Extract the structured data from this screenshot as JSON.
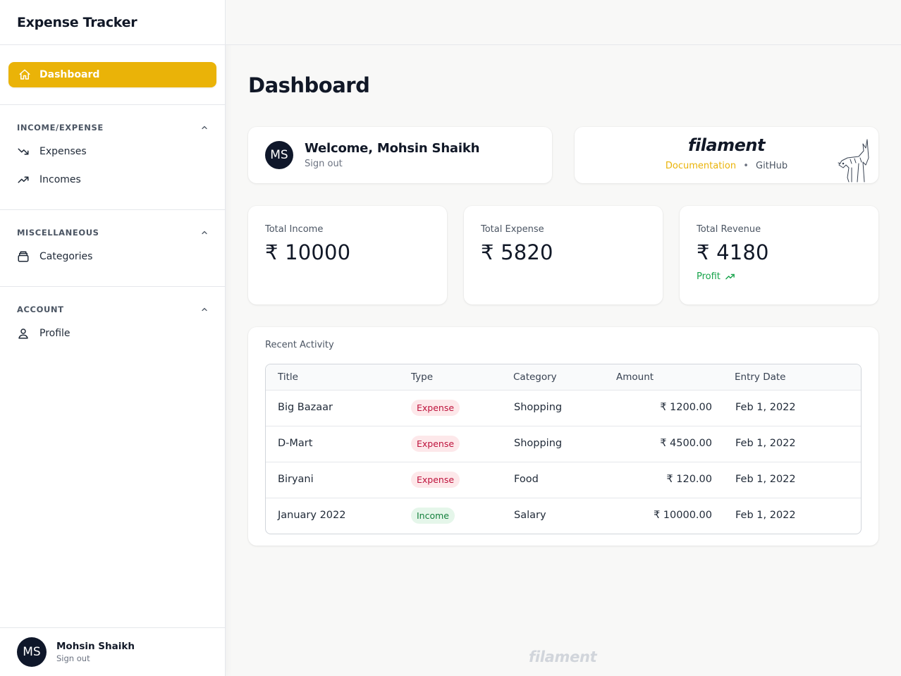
{
  "app": {
    "title": "Expense Tracker"
  },
  "sidebar": {
    "active_item": {
      "label": "Dashboard",
      "icon": "home-icon"
    },
    "groups": [
      {
        "label": "INCOME/EXPENSE",
        "items": [
          {
            "label": "Expenses",
            "icon": "trending-down-icon"
          },
          {
            "label": "Incomes",
            "icon": "trending-up-icon"
          }
        ]
      },
      {
        "label": "MISCELLANEOUS",
        "items": [
          {
            "label": "Categories",
            "icon": "archive-icon"
          }
        ]
      },
      {
        "label": "ACCOUNT",
        "items": [
          {
            "label": "Profile",
            "icon": "user-icon"
          }
        ]
      }
    ],
    "footer": {
      "initials": "MS",
      "name": "Mohsin Shaikh",
      "sign_out": "Sign out"
    }
  },
  "page": {
    "title": "Dashboard"
  },
  "welcome": {
    "initials": "MS",
    "title": "Welcome, Mohsin Shaikh",
    "sign_out": "Sign out"
  },
  "filament": {
    "logo": "filament",
    "documentation": "Documentation",
    "separator": "•",
    "github": "GitHub"
  },
  "stats": [
    {
      "label": "Total Income",
      "value": "₹ 10000"
    },
    {
      "label": "Total Expense",
      "value": "₹ 5820"
    },
    {
      "label": "Total Revenue",
      "value": "₹ 4180",
      "description": "Profit",
      "description_color": "#16a34a"
    }
  ],
  "activity": {
    "title": "Recent Activity",
    "columns": [
      "Title",
      "Type",
      "Category",
      "Amount",
      "Entry Date"
    ],
    "rows": [
      {
        "title": "Big Bazaar",
        "type": "Expense",
        "category": "Shopping",
        "amount": "₹ 1200.00",
        "date": "Feb 1, 2022"
      },
      {
        "title": "D-Mart",
        "type": "Expense",
        "category": "Shopping",
        "amount": "₹ 4500.00",
        "date": "Feb 1, 2022"
      },
      {
        "title": "Biryani",
        "type": "Expense",
        "category": "Food",
        "amount": "₹ 120.00",
        "date": "Feb 1, 2022"
      },
      {
        "title": "January 2022",
        "type": "Income",
        "category": "Salary",
        "amount": "₹ 10000.00",
        "date": "Feb 1, 2022"
      }
    ]
  },
  "footer": {
    "logo": "filament"
  },
  "colors": {
    "accent": "#eab308",
    "expense": "#be123c",
    "income": "#15803d"
  }
}
